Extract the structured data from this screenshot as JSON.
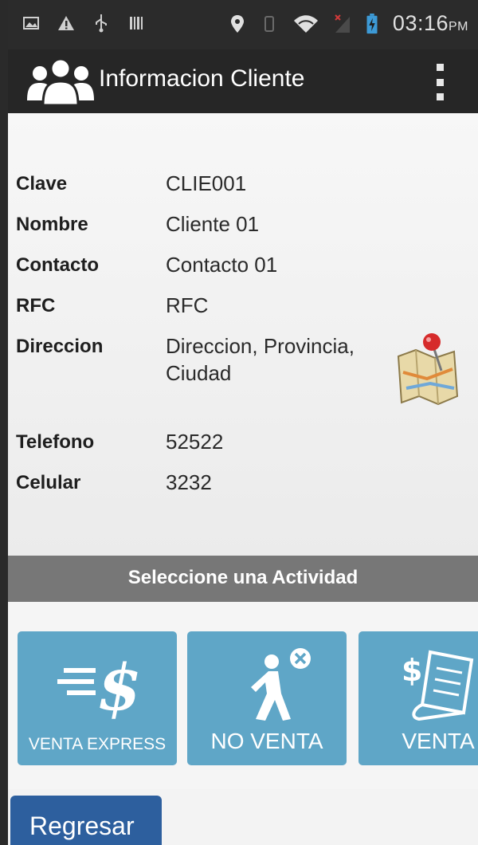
{
  "status_bar": {
    "time": "03:16",
    "ampm": "PM",
    "icons": [
      "image-icon",
      "warning-icon",
      "usb-icon",
      "barcode-icon",
      "location-icon",
      "vibrate-icon",
      "wifi-icon",
      "signal-off-icon",
      "battery-charging-icon"
    ]
  },
  "action_bar": {
    "title": "Informacion Cliente",
    "logo_icon": "users-group-icon",
    "menu_icon": "overflow-menu-icon"
  },
  "client": {
    "clave_label": "Clave",
    "clave_value": "CLIE001",
    "nombre_label": "Nombre",
    "nombre_value": "Cliente 01",
    "contacto_label": "Contacto",
    "contacto_value": "Contacto 01",
    "rfc_label": "RFC",
    "rfc_value": "RFC",
    "direccion_label": "Direccion",
    "direccion_line1": "Direccion, Provincia,",
    "direccion_line2": "Ciudad",
    "telefono_label": "Telefono",
    "telefono_value": "52522",
    "celular_label": "Celular",
    "celular_value": "3232",
    "map_icon": "map-pin-icon"
  },
  "activity": {
    "header": "Seleccione una Actividad",
    "tiles": [
      {
        "label": "VENTA EXPRESS",
        "icon": "dollar-speed-icon"
      },
      {
        "label": "NO VENTA",
        "icon": "walking-person-cancel-icon"
      },
      {
        "label": "VENTA",
        "icon": "receipt-dollar-icon"
      }
    ]
  },
  "footer": {
    "back_label": "Regresar"
  },
  "colors": {
    "tile_bg": "#5fa6c7",
    "activity_bar": "#777777",
    "back_button": "#2d5f9e",
    "action_bar": "#262626"
  }
}
